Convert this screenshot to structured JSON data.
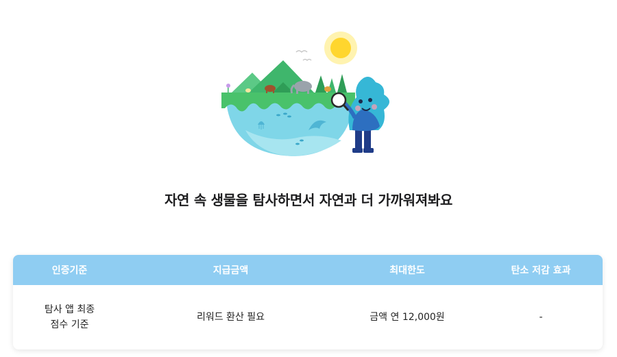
{
  "headline": "자연 속 생물을 탐사하면서 자연과 더 가까워져봐요",
  "table": {
    "headers": [
      "인증기준",
      "지급금액",
      "최대한도",
      "탄소 저감 효과"
    ],
    "row": {
      "criteria_line1": "탐사 앱 최종",
      "criteria_line2": "점수 기준",
      "payment": "리워드 환산 필요",
      "limit": "금액 연 12,000원",
      "carbon": "-"
    }
  },
  "colors": {
    "header_bg": "#8fcdf2",
    "header_text": "#ffffff",
    "body_text": "#222222"
  },
  "illustration": {
    "name": "nature-exploration-illustration",
    "elements": [
      "sun-icon",
      "mountain-icon",
      "tree-icon",
      "animal-icon",
      "fish-icon",
      "dolphin-icon",
      "jellyfish-icon",
      "mascot-character",
      "magnifier-icon",
      "bird-icon",
      "flower-icon"
    ]
  }
}
